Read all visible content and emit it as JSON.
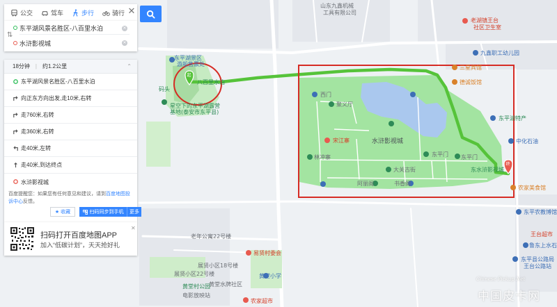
{
  "colors": {
    "accent": "#3385ff",
    "route": "#56c33a",
    "park": "#a3e4a1",
    "highlight": "#d62b24",
    "water": "#aac8ee"
  },
  "tabs": [
    {
      "label": "公交",
      "icon": "bus-icon"
    },
    {
      "label": "驾车",
      "icon": "car-icon"
    },
    {
      "label": "步行",
      "icon": "walk-icon",
      "active": true
    },
    {
      "label": "骑行",
      "icon": "bike-icon"
    }
  ],
  "route": {
    "start": "东平湖风景名胜区-八百里水泊",
    "end": "水浒影视城",
    "summary_time": "18分钟",
    "summary_distance": "约1.2公里"
  },
  "steps": [
    {
      "text": "东平湖风景名胜区-八百里水泊",
      "icon": "start-dot-icon"
    },
    {
      "text": "向正东方向出发,走10米,右转",
      "icon": "turn-right-icon"
    },
    {
      "text": "走760米,右转",
      "icon": "turn-right-icon"
    },
    {
      "text": "走360米,右转",
      "icon": "turn-right-icon"
    },
    {
      "text": "走40米,左转",
      "icon": "turn-left-icon"
    },
    {
      "text": "走40米,到达终点",
      "icon": "straight-icon"
    },
    {
      "text": "水浒影视城",
      "icon": "end-dot-icon"
    }
  ],
  "feedback": {
    "prefix": "百度提醒您：如果您有任何意见和建议，请到",
    "link": "百度地图投诉中心",
    "suffix": "反馈。"
  },
  "actions": {
    "favorite": "收藏",
    "send": "扫码同步到手机",
    "more": "更多"
  },
  "promo": {
    "title": "扫码打开百度地图APP",
    "subtitle": "加入“低碳计划”，天天抢好礼"
  },
  "map_labels": {
    "factory": "山东九鑫机械",
    "factory2": "工具有限公司",
    "clinic": "老湖镇王台",
    "clinic2": "社区卫生室",
    "scenic": "东平湖景区",
    "scenic2": "游船售票处",
    "eight_hundred": "八百里水泊",
    "small_park": "码头",
    "star": "星空下的东平湖露营",
    "star2": "基地(泰安市东平县)",
    "kindergarten": "九鑫职工幼儿园",
    "hotel": "三星宾馆",
    "restaurant": "德诚饭馆",
    "jiangjun": "东平湖特产",
    "yi_ma": "中化石油",
    "xixian": "西门",
    "zhongyi": "聚义厅",
    "film_city": "水浒影视城",
    "gate": "东平门",
    "baojiawu": "宋江寨",
    "shaojiu": "东平门",
    "dalan": "大关古街",
    "jiaoyu": "林冲寨",
    "hongchuan": "书香阁",
    "fengchu": "阿丽阁",
    "east_film": "东水浒影视城",
    "food": "农家美食馆",
    "lhotel": "东平农教博馆",
    "wangtai": "王台超市",
    "lushui": "鲁东上水石街",
    "bus": "东平县公路局",
    "bus2": "王台公路站",
    "road1": "老年公寓22号楼",
    "mingxian": "易贤村委会",
    "school": "黄堂小学",
    "xiaozhan": "黄堂水牌社区",
    "villa": "黄堂村公园",
    "cinema": "电影放映站",
    "market": "农家超市",
    "road2": "展贤小区18号楼",
    "road3": "展贤小区22号楼"
  },
  "watermark": {
    "text": "中国皮卡网",
    "small": "Chinese Pickup Net"
  }
}
